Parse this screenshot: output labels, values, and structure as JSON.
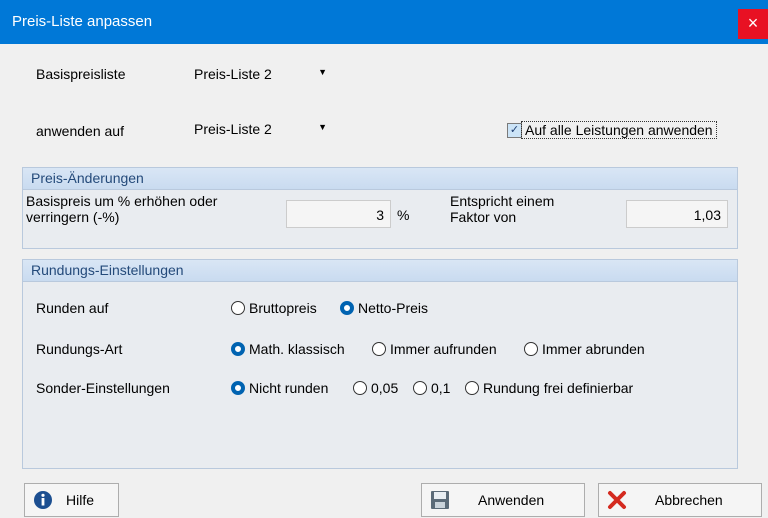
{
  "window": {
    "title": "Preis-Liste anpassen",
    "close_glyph": "×"
  },
  "top": {
    "basis_label": "Basispreisliste",
    "basis_value": "Preis-Liste 2",
    "apply_label": "anwenden auf",
    "apply_value": "Preis-Liste 2",
    "all_services_label": "Auf alle Leistungen anwenden",
    "all_services_checked": true
  },
  "price_changes": {
    "title": "Preis-Änderungen",
    "percent_label_line1": "Basispreis um % erhöhen oder",
    "percent_label_line2": "verringern (-%)",
    "percent_value": "3",
    "percent_unit": "%",
    "factor_label_line1": "Entspricht einem",
    "factor_label_line2": "Faktor von",
    "factor_value": "1,03"
  },
  "rounding": {
    "title": "Rundungs-Einstellungen",
    "round_on_label": "Runden auf",
    "round_on_options": [
      "Bruttopreis",
      "Netto-Preis"
    ],
    "round_on_selected": "Netto-Preis",
    "type_label": "Rundungs-Art",
    "type_options": [
      "Math. klassisch",
      "Immer aufrunden",
      "Immer abrunden"
    ],
    "type_selected": "Math. klassisch",
    "special_label": "Sonder-Einstellungen",
    "special_options": [
      "Nicht runden",
      "0,05",
      "0,1",
      "Rundung frei definierbar"
    ],
    "special_selected": "Nicht runden"
  },
  "buttons": {
    "help": "Hilfe",
    "apply": "Anwenden",
    "cancel": "Abbrechen"
  },
  "icons": {
    "help": "info-icon",
    "apply": "floppy-disk-icon",
    "cancel": "red-x-icon"
  },
  "colors": {
    "titlebar": "#0078d7",
    "close": "#e81123",
    "accent": "#0063b1"
  }
}
